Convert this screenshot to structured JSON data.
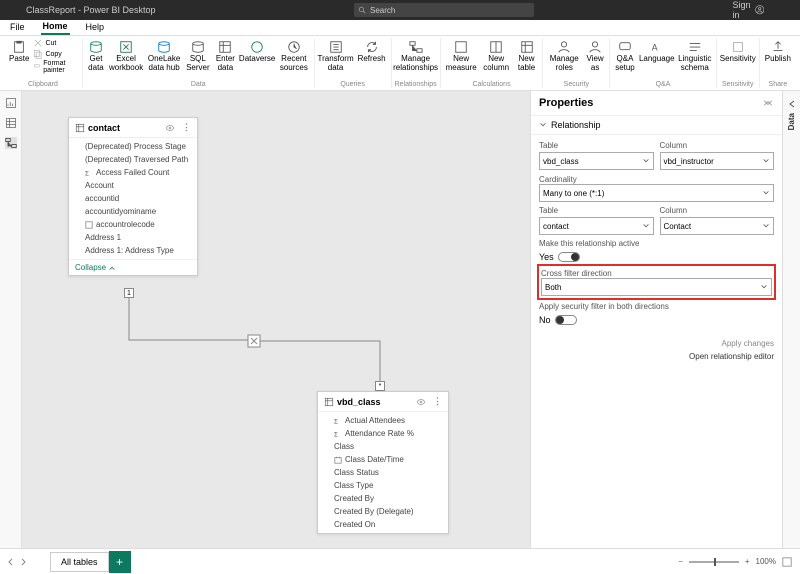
{
  "titlebar": {
    "app_title": "ClassReport - Power BI Desktop",
    "search_placeholder": "Search",
    "signin": "Sign in"
  },
  "menubar": {
    "file": "File",
    "home": "Home",
    "help": "Help"
  },
  "ribbon": {
    "clipboard": {
      "paste": "Paste",
      "cut": "Cut",
      "copy": "Copy",
      "format": "Format painter",
      "label": "Clipboard"
    },
    "data": {
      "get": "Get data",
      "excel": "Excel workbook",
      "onelake": "OneLake data hub",
      "sql": "SQL Server",
      "enter": "Enter data",
      "dataverse": "Dataverse",
      "recent": "Recent sources",
      "label": "Data"
    },
    "queries": {
      "transform": "Transform data",
      "refresh": "Refresh",
      "label": "Queries"
    },
    "relationships": {
      "manage": "Manage relationships",
      "label": "Relationships"
    },
    "calculations": {
      "newmeasure": "New measure",
      "newcolumn": "New column",
      "newtable": "New table",
      "label": "Calculations"
    },
    "security": {
      "manageroles": "Manage roles",
      "viewas": "View as",
      "label": "Security"
    },
    "qa": {
      "qasetup": "Q&A setup",
      "language": "Language",
      "linguistic": "Linguistic schema",
      "label": "Q&A"
    },
    "sensitivity": {
      "sensitivity": "Sensitivity",
      "label": "Sensitivity"
    },
    "share": {
      "publish": "Publish",
      "label": "Share"
    }
  },
  "tables": {
    "contact": {
      "name": "contact",
      "fields": [
        "(Deprecated) Process Stage",
        "(Deprecated) Traversed Path",
        "Access Failed Count",
        "Account",
        "accountid",
        "accountidyominame",
        "accountrolecode",
        "Address 1",
        "Address 1: Address Type"
      ],
      "collapse": "Collapse"
    },
    "vbd_class": {
      "name": "vbd_class",
      "fields": [
        "Actual Attendees",
        "Attendance Rate %",
        "Class",
        "Class Date/Time",
        "Class Status",
        "Class Type",
        "Created By",
        "Created By (Delegate)",
        "Created On"
      ]
    }
  },
  "properties": {
    "title": "Properties",
    "section": "Relationship",
    "table_lbl": "Table",
    "column_lbl": "Column",
    "table1": "vbd_class",
    "column1": "vbd_instructor",
    "cardinality_lbl": "Cardinality",
    "cardinality": "Many to one (*:1)",
    "table2": "contact",
    "column2": "Contact",
    "active_lbl": "Make this relationship active",
    "yes": "Yes",
    "crossfilter_lbl": "Cross filter direction",
    "crossfilter": "Both",
    "security_lbl": "Apply security filter in both directions",
    "no": "No",
    "apply": "Apply changes",
    "editor": "Open relationship editor"
  },
  "rightbar": {
    "data": "Data"
  },
  "statusbar": {
    "alltables": "All tables",
    "zoom": "100%"
  }
}
